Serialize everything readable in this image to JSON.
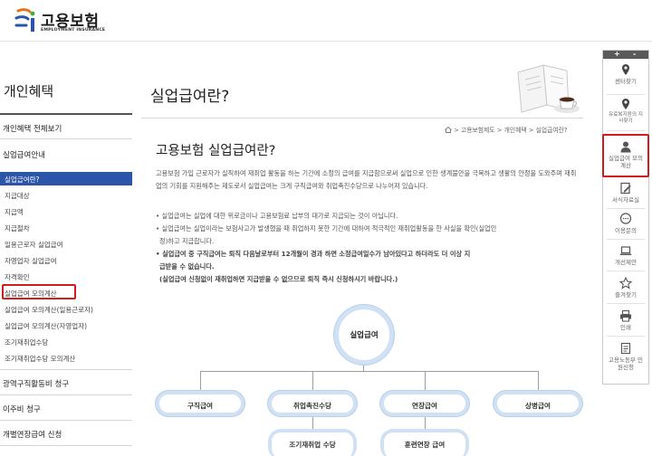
{
  "header": {
    "logo_text": "고용보험",
    "logo_sub": "EMPLOYMENT INSURANCE"
  },
  "sidebar": {
    "title": "개인혜택",
    "all_view": "개인혜택 전체보기",
    "section": "실업급여안내",
    "items": [
      "실업급여란?",
      "지급대상",
      "지급액",
      "지급절차",
      "일용근로자 실업급여",
      "자영업자 실업급여",
      "자격확인",
      "실업급여 모의계산",
      "실업급여 모의계산(일용근로자)",
      "실업급여 모의계산(자영업자)",
      "조기재취업수당",
      "조기재취업수당 모의계산"
    ],
    "bottom": [
      "광역구직활동비 청구",
      "이주비 청구",
      "개별연장급여 신청"
    ]
  },
  "main": {
    "page_title": "실업급여란?",
    "breadcrumb": [
      "고용보험제도",
      "개인혜택",
      "실업급여란?"
    ],
    "heading": "고용보험 실업급여란?",
    "intro": "고용보험 가입 근로자가 실직하여 재취업 활동을 하는 기간에 소정의 급여를 지급함으로써 실업으로 인한 생계불안을 극복하고 생활의 안정을 도와주며 재취업의 기회를 지원해주는 제도로서 실업급여는 크게 구직급여와 취업촉진수당으로 나누어져 있습니다.",
    "bullets": [
      "• 실업급여는 실업에 대한 위로금이나 고용보험료 납부의 대가로 지급되는 것이 아닙니다.",
      "• 실업급여는 실업이라는 보험사고가 발생했을 때 취업하지 못한 기간에 대하여 적극적인 재취업활동을 한 사실을 확인(실업인",
      "정)하고 지급합니다.",
      "• 실업급여 중 구직급여는 퇴직 다음날로부터 12개월이 경과 하면 소정급여일수가 남아있다고 하더라도 더 이상 지",
      "급받을 수 없습니다.",
      "(실업급여 신청없이 재취업하면 지급받을 수 없으므로 퇴직 즉시 신청하시기 바랍니다.)"
    ],
    "diagram": {
      "center": "실업급여",
      "row1": [
        "구직급여",
        "취업촉진수당",
        "연장급여",
        "상병급여"
      ],
      "row2": [
        "조기재취업 수당",
        "훈련연장 급여"
      ]
    }
  },
  "quick_menu": {
    "controls": [
      "+",
      "-"
    ],
    "items": [
      {
        "label": "센터찾기",
        "icon": "location-pin-icon"
      },
      {
        "label": "유료복지원의 지사찾기",
        "icon": "location-pin-icon"
      },
      {
        "label": "실업급여 모의계산",
        "icon": "person-icon"
      },
      {
        "label": "서식자료실",
        "icon": "form-edit-icon"
      },
      {
        "label": "이용문의",
        "icon": "speech-bubble-icon"
      },
      {
        "label": "개선제안",
        "icon": "laptop-icon"
      },
      {
        "label": "즐겨찾기",
        "icon": "star-icon"
      },
      {
        "label": "인쇄",
        "icon": "printer-icon"
      },
      {
        "label": "고용노동부 민원신청",
        "icon": "document-icon"
      }
    ]
  },
  "colors": {
    "accent_blue": "#2c55a8",
    "highlight_red": "#d21b1b",
    "diagram_border": "#cfe1f2"
  }
}
